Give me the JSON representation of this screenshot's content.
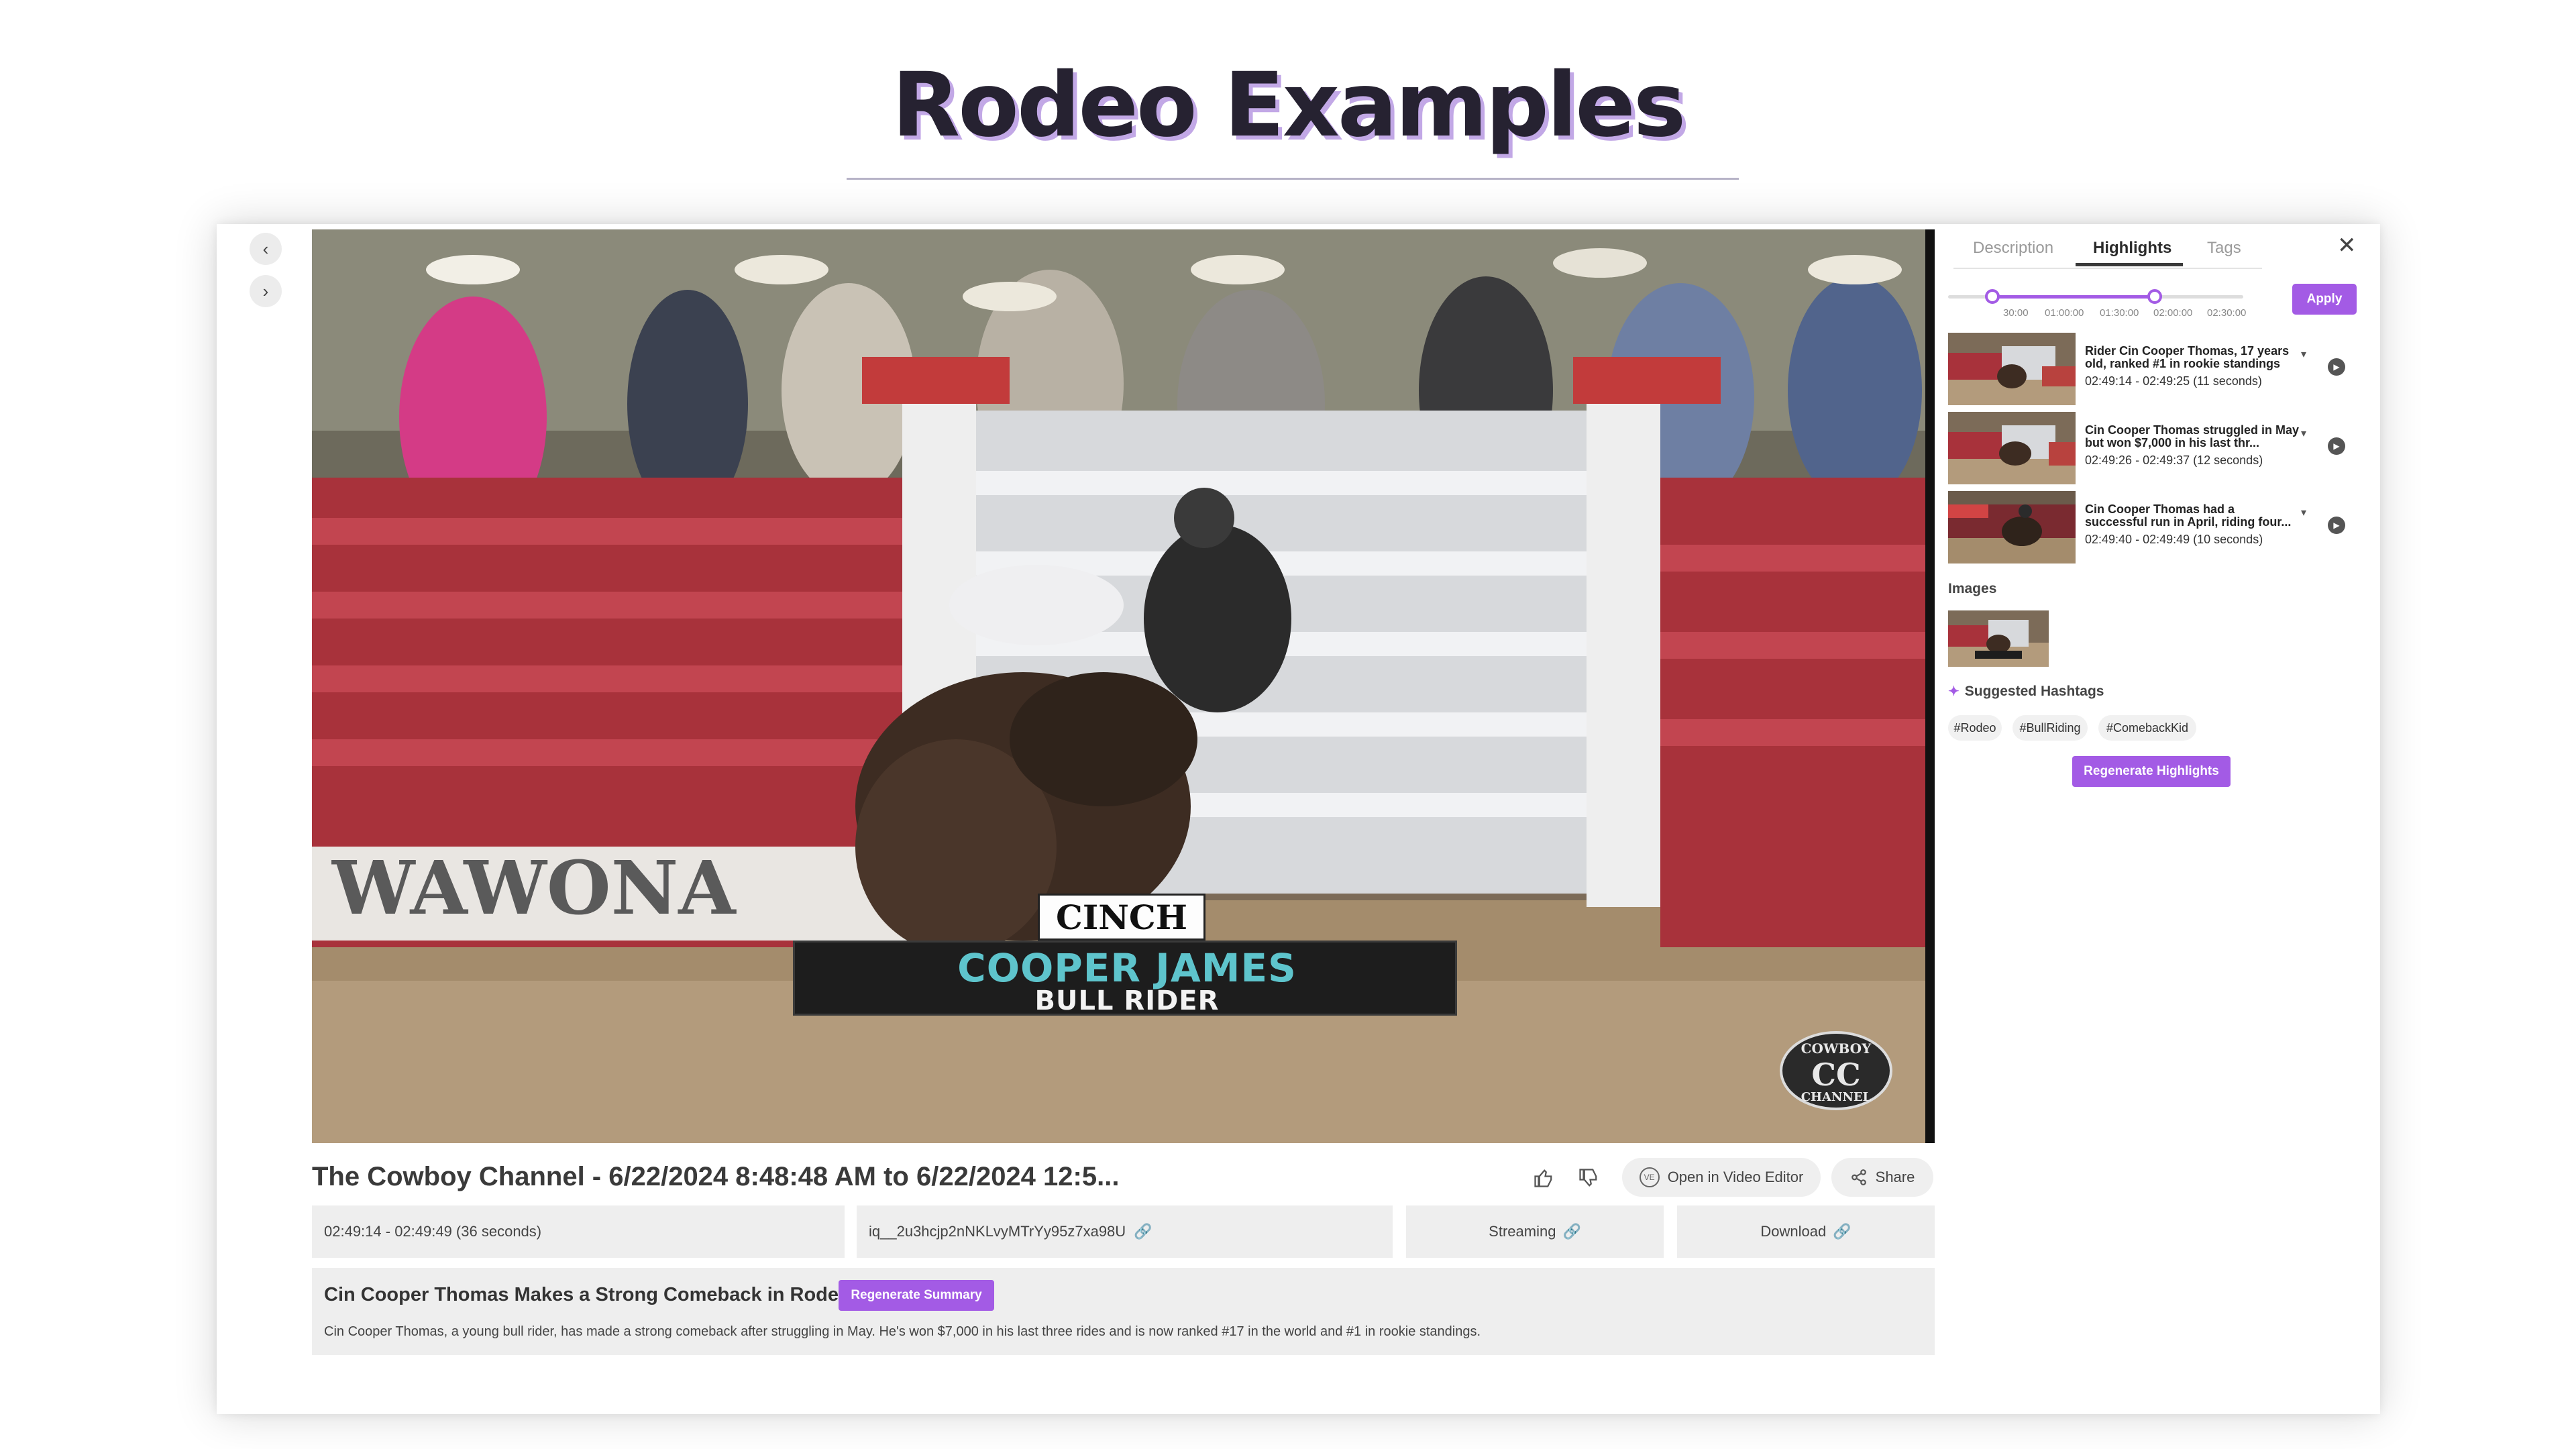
{
  "page": {
    "title": "Rodeo Examples"
  },
  "video": {
    "overlay": {
      "sponsor": "CINCH",
      "rider_name": "COOPER JAMES",
      "rider_role": "BULL RIDER"
    },
    "logo": {
      "top": "COWBOY",
      "mark": "CC",
      "bottom": "CHANNEL"
    },
    "title": "The Cowboy Channel - 6/22/2024 8:48:48 AM to 6/22/2024 12:5..."
  },
  "actions": {
    "open_editor": "Open in Video Editor",
    "share": "Share"
  },
  "info": {
    "time_range": "02:49:14 - 02:49:49 (36 seconds)",
    "asset_id": "iq__2u3hcjp2nNKLvyMTrYy95z7xa98U",
    "streaming": "Streaming",
    "download": "Download"
  },
  "summary": {
    "title": "Cin Cooper Thomas Makes a Strong Comeback in Rodeo",
    "regenerate": "Regenerate Summary",
    "text": "Cin Cooper Thomas, a young bull rider, has made a strong comeback after struggling in May. He's won $7,000 in his last three rides and is now ranked #17 in the world and #1 in rookie standings."
  },
  "sidebar": {
    "tabs": [
      {
        "label": "Description"
      },
      {
        "label": "Highlights"
      },
      {
        "label": "Tags"
      }
    ],
    "active_tab": "Highlights",
    "slider": {
      "labels": [
        "30:00",
        "01:00:00",
        "01:30:00",
        "02:00:00",
        "02:30:00"
      ],
      "range_fraction": [
        0.15,
        0.7
      ]
    },
    "apply": "Apply",
    "highlights": [
      {
        "title": "Rider Cin Cooper Thomas, 17 years old, ranked #1 in rookie standings",
        "time": "02:49:14 - 02:49:25 (11 seconds)"
      },
      {
        "title": "Cin Cooper Thomas struggled in May but won $7,000 in his last thr...",
        "time": "02:49:26 - 02:49:37 (12 seconds)"
      },
      {
        "title": "Cin Cooper Thomas had a successful run in April, riding four...",
        "time": "02:49:40 - 02:49:49 (10 seconds)"
      }
    ],
    "images_label": "Images",
    "hashtags_label": "Suggested Hashtags",
    "hashtags": [
      "#Rodeo",
      "#BullRiding",
      "#ComebackKid"
    ],
    "regenerate_highlights": "Regenerate Highlights"
  },
  "colors": {
    "accent": "#a35be5",
    "title_shadow": "#c2a8e6"
  }
}
